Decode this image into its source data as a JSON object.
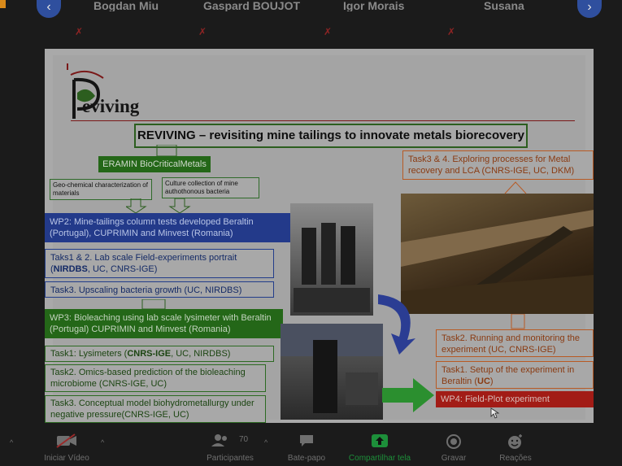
{
  "participants_strip": {
    "names": [
      "Bogdan Miu",
      "Gaspard BOUJOT",
      "Igor Morais",
      "Susana"
    ],
    "muted_icon": "microphone-muted-icon"
  },
  "slide": {
    "logo_text": "eviving",
    "title": "REVIVING – revisiting mine tailings to innovate metals biorecovery",
    "eramin": "ERAMIN BioCriticalMetals",
    "geo_chem": "Geo-chemical characterization of materials",
    "culture": "Culture collection of mine authothonous bacteria",
    "wp2": "WP2: Mine-tailings column tests developed Beraltin (Portugal), CUPRIMIN and Minvest (Romania)",
    "task12_prefix": "Taks1 & 2. Lab scale Field-experiments portrait (",
    "task12_bold": "NIRDBS",
    "task12_suffix": ", UC, CNRS-IGE)",
    "task3_upscale": "Task3. Upscaling bacteria growth (UC, NIRDBS)",
    "wp3": "WP3: Bioleaching using lab scale lysimeter with Beraltin (Portugal) CUPRIMIN and Minvest (Romania)",
    "task1_lys_prefix": "Task1: Lysimeters (",
    "task1_lys_bold": "CNRS-IGE",
    "task1_lys_suffix": ", UC, NIRDBS)",
    "task2_omics": "Task2. Omics-based prediction of the bioleaching microbiome (CNRS-IGE, UC)",
    "task3_model": "Task3. Conceptual model biohydrometallurgy under negative pressure(CNRS-IGE, UC)",
    "task34": "Task3 & 4. Exploring processes for Metal recovery and LCA (CNRS-IGE, UC, DKM)",
    "task2_run": "Task2. Running and monitoring the experiment (UC, CNRS-IGE)",
    "task1_setup_prefix": "Task1. Setup of the experiment in Beraltin (",
    "task1_setup_bold": "UC",
    "task1_setup_suffix": ")",
    "wp4": "WP4: Field-Plot experiment"
  },
  "toolbar": {
    "start_video": "Iniciar Vídeo",
    "participants_count": "70",
    "participants": "Participantes",
    "chat": "Bate-papo",
    "share": "Compartilhar tela",
    "record": "Gravar",
    "reactions": "Reações"
  },
  "colors": {
    "share_green": "#1d8f3a",
    "accent_blue": "#2f4f9e",
    "wp4_red": "#a21c16"
  }
}
